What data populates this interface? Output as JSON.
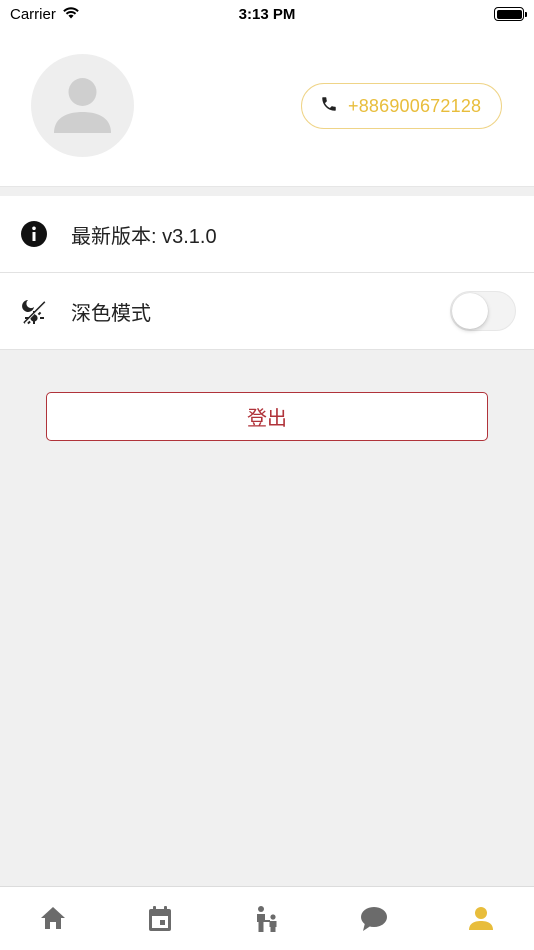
{
  "status_bar": {
    "carrier": "Carrier",
    "time": "3:13 PM"
  },
  "profile": {
    "phone": "+886900672128"
  },
  "settings": {
    "version_label": "最新版本: v3.1.0",
    "dark_mode_label": "深色模式",
    "dark_mode_on": false
  },
  "logout_label": "登出",
  "tab_bar": {
    "tabs": [
      "home-icon",
      "calendar-icon",
      "family-icon",
      "chat-icon",
      "person-icon"
    ],
    "active_index": 4
  },
  "colors": {
    "accent": "#e8bd3b",
    "logout": "#b0333a",
    "tab_inactive": "#6b6b6b",
    "background": "#f0f0f0"
  }
}
